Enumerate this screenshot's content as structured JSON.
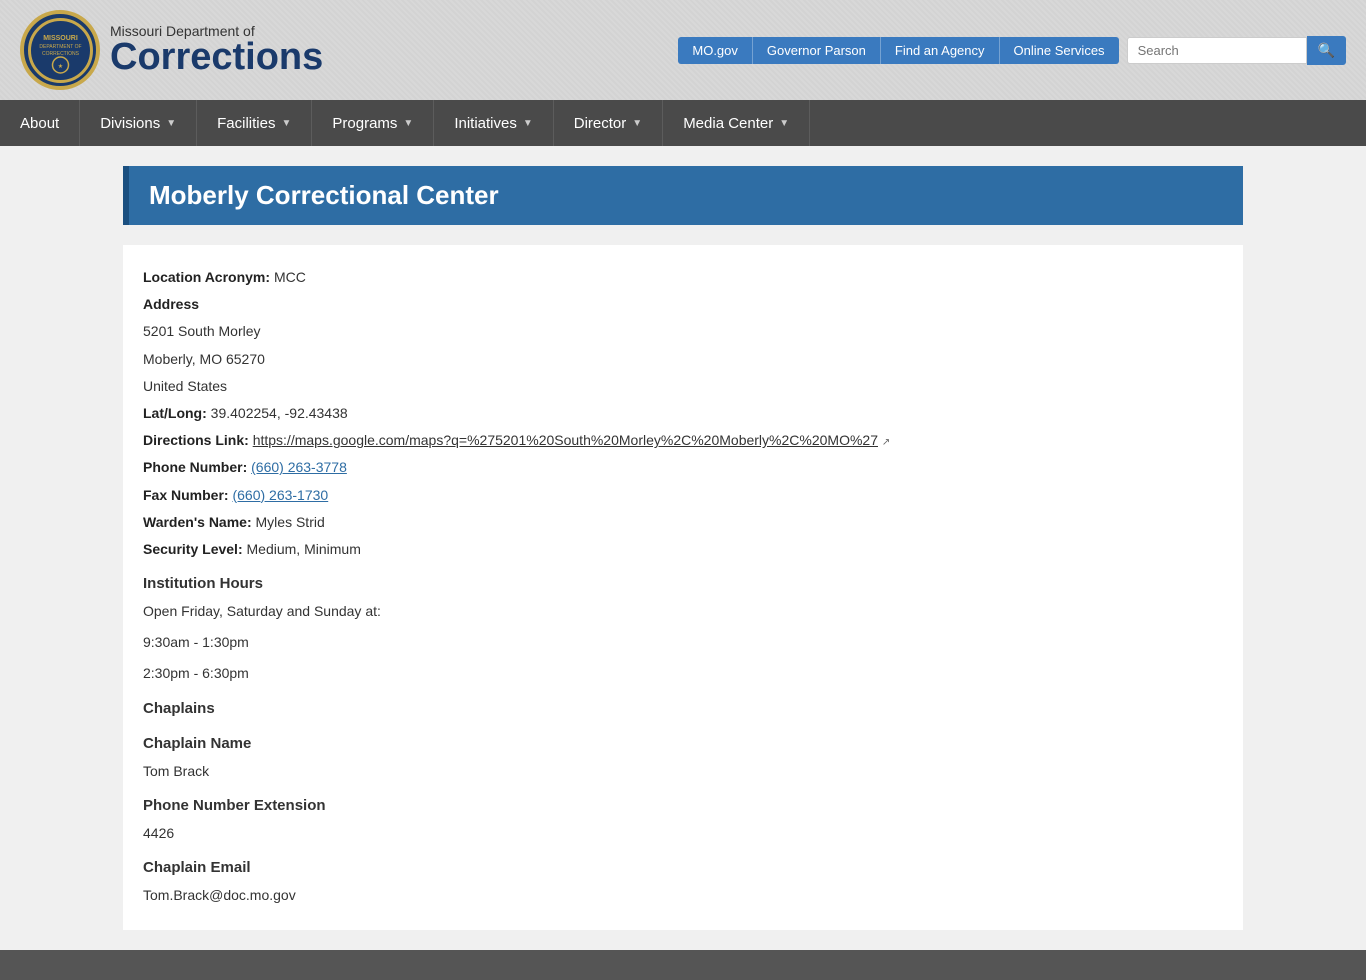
{
  "topnav": {
    "links": [
      {
        "label": "MO.gov",
        "url": "#"
      },
      {
        "label": "Governor Parson",
        "url": "#"
      },
      {
        "label": "Find an Agency",
        "url": "#"
      },
      {
        "label": "Online Services",
        "url": "#"
      }
    ],
    "search_placeholder": "Search"
  },
  "logo": {
    "dept_line1": "Missouri Department of",
    "dept_line2": "Corrections"
  },
  "mainnav": {
    "items": [
      {
        "label": "About",
        "has_arrow": false
      },
      {
        "label": "Divisions",
        "has_arrow": true
      },
      {
        "label": "Facilities",
        "has_arrow": true
      },
      {
        "label": "Programs",
        "has_arrow": true
      },
      {
        "label": "Initiatives",
        "has_arrow": true
      },
      {
        "label": "Director",
        "has_arrow": true
      },
      {
        "label": "Media Center",
        "has_arrow": true
      }
    ]
  },
  "page": {
    "title": "Moberly Correctional Center",
    "fields": {
      "location_acronym_label": "Location Acronym:",
      "location_acronym_value": "MCC",
      "address_label": "Address",
      "address_line1": "5201 South Morley",
      "address_line2": "Moberly, MO 65270",
      "address_line3": "United States",
      "latlong_label": "Lat/Long:",
      "latlong_value": "39.402254, -92.43438",
      "directions_label": "Directions Link:",
      "directions_url": "https://maps.google.com/maps?q=%275201%20South%20Morley%2C%20Moberly%2C%20MO%27",
      "directions_text": "https://maps.google.com/maps?q=%275201%20South%20Morley%2C%20Moberly%2C%20MO%27",
      "phone_label": "Phone Number:",
      "phone_value": "(660) 263-3778",
      "fax_label": "Fax Number:",
      "fax_value": "(660) 263-1730",
      "warden_label": "Warden's Name:",
      "warden_value": "Myles Strid",
      "security_label": "Security Level:",
      "security_value": "Medium, Minimum",
      "institution_hours_heading": "Institution Hours",
      "hours_line1": "Open Friday, Saturday and Sunday at:",
      "hours_time1": "9:30am - 1:30pm",
      "hours_time2": "2:30pm - 6:30pm",
      "chaplains_heading": "Chaplains",
      "chaplain_name_heading": "Chaplain Name",
      "chaplain_name_value": "Tom Brack",
      "phone_ext_heading": "Phone Number Extension",
      "phone_ext_value": "4426",
      "chaplain_email_heading": "Chaplain Email",
      "chaplain_email_value": "Tom.Brack@doc.mo.gov"
    }
  }
}
